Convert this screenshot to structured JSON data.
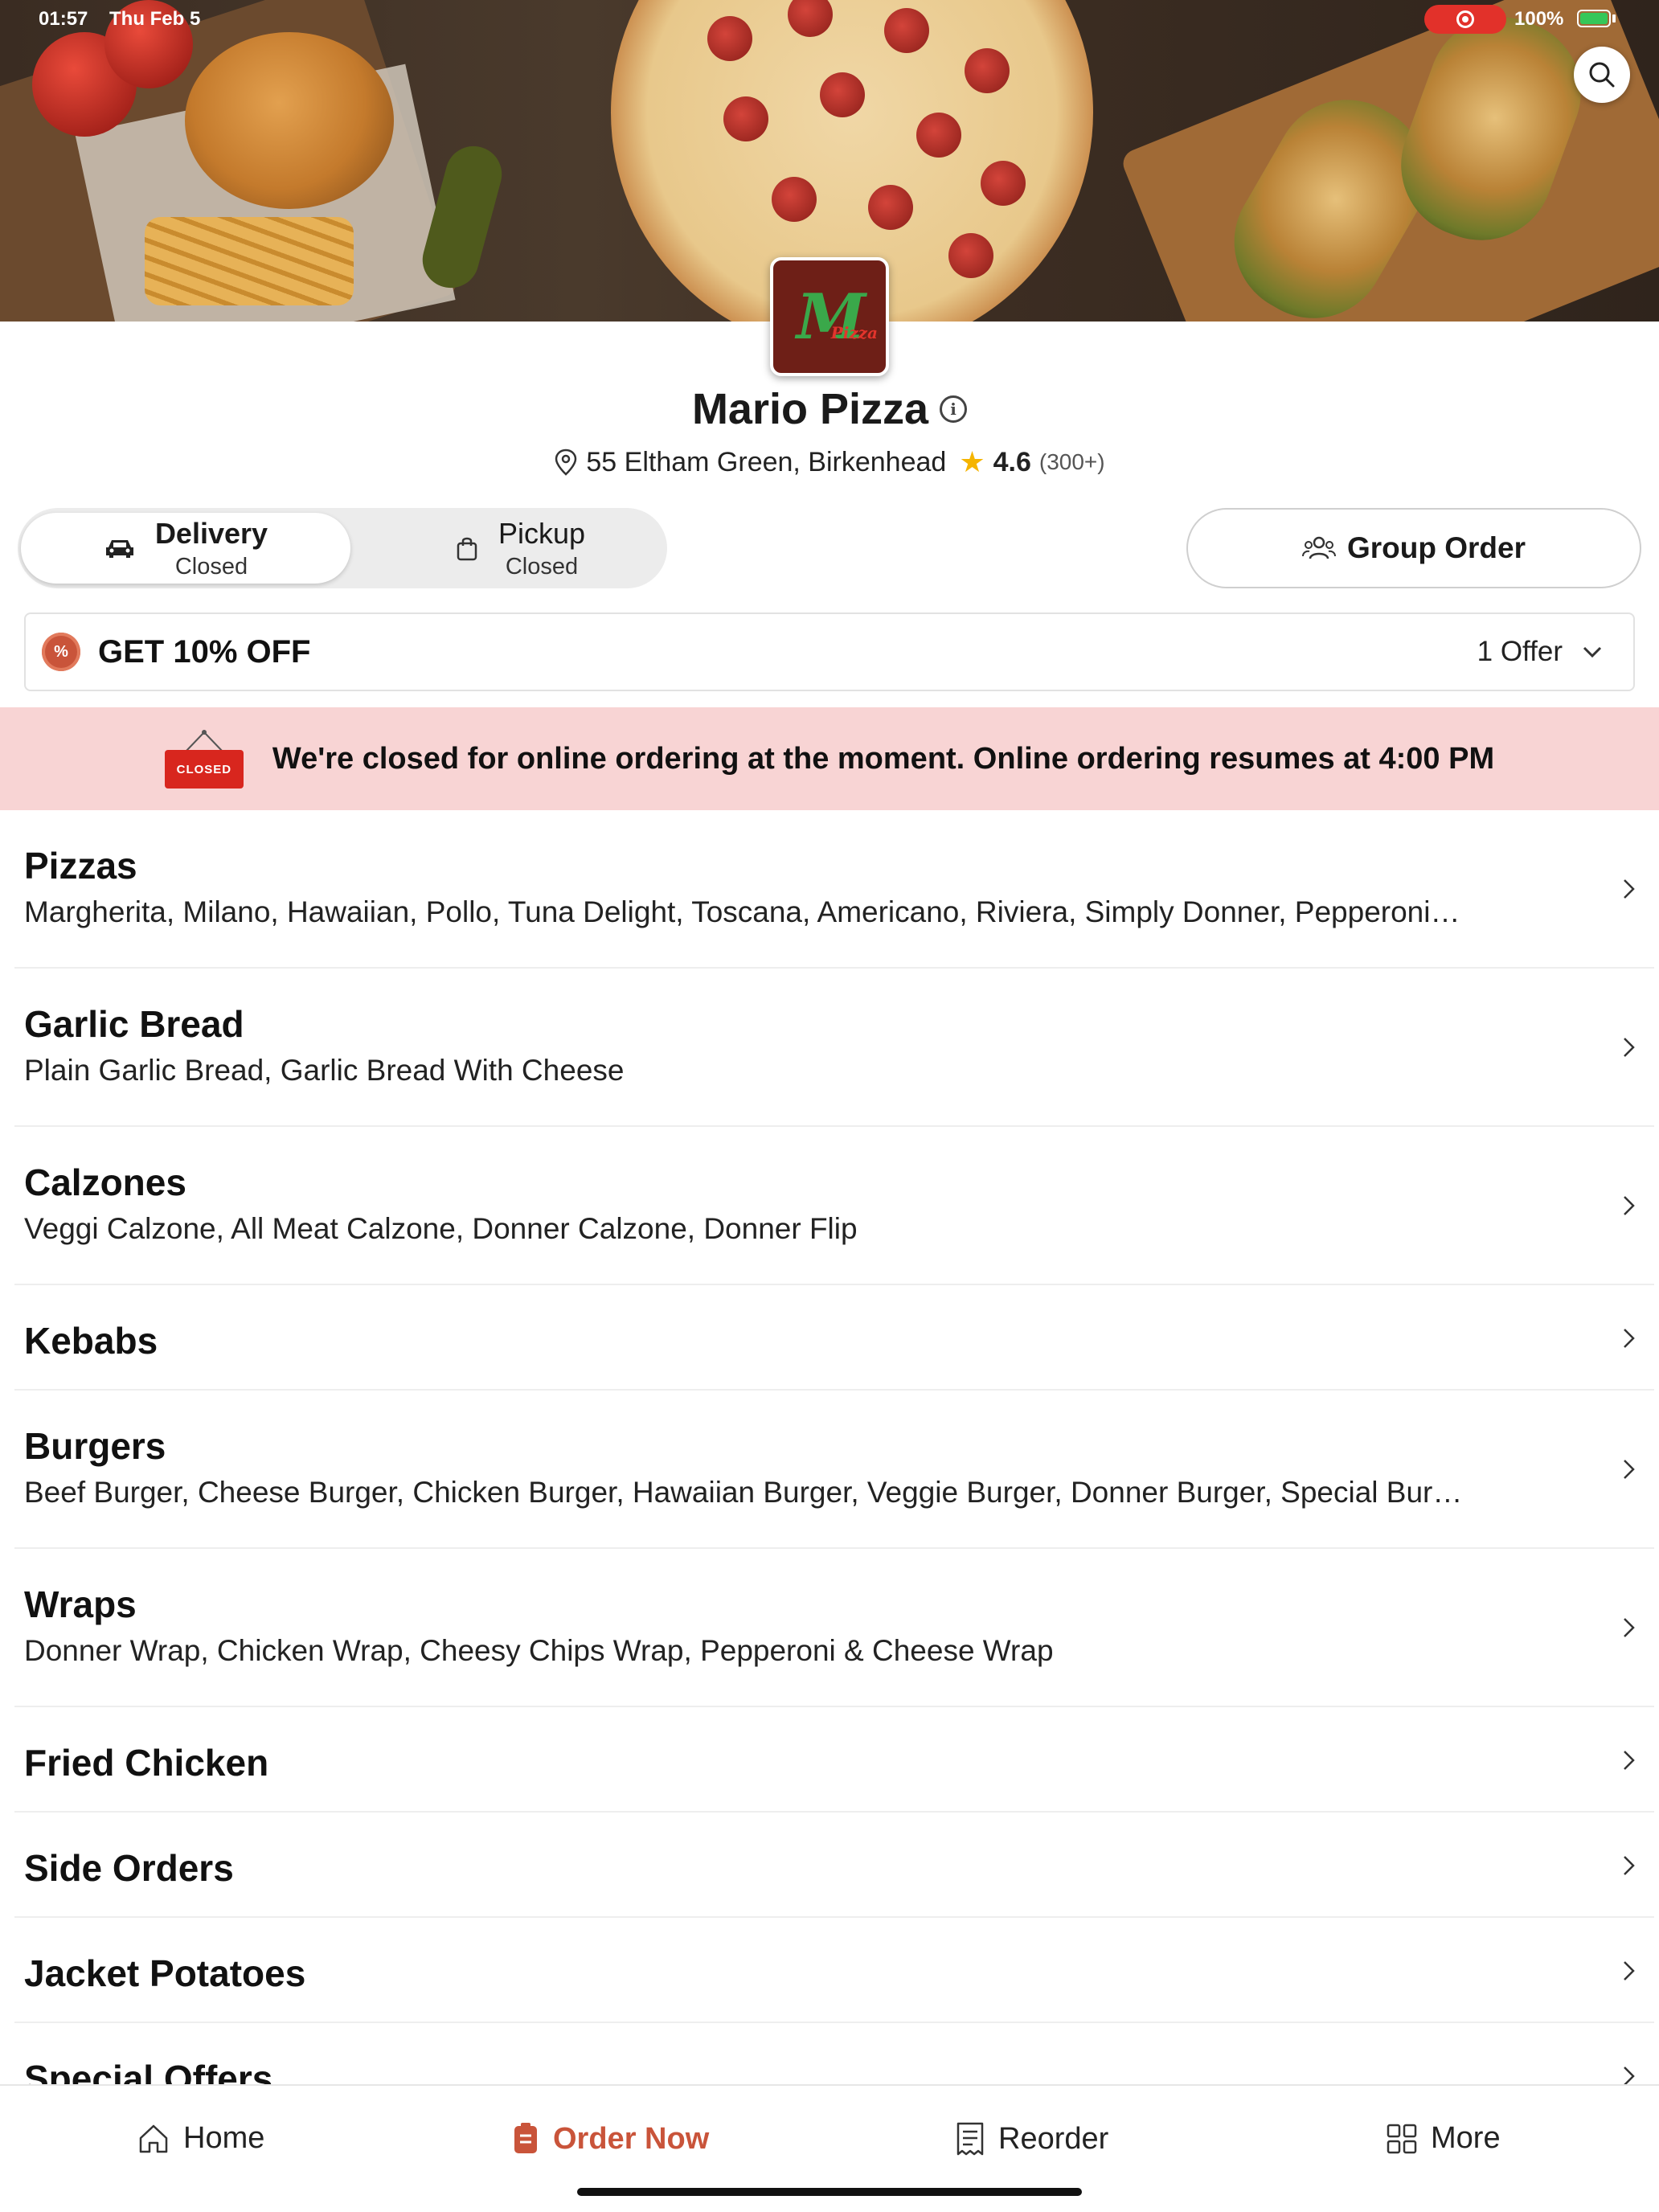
{
  "status_bar": {
    "time": "01:57",
    "date": "Thu Feb 5",
    "battery": "100%"
  },
  "restaurant": {
    "name": "Mario Pizza",
    "address": "55 Eltham Green, Birkenhead",
    "rating": "4.6",
    "rating_count": "(300+)",
    "logo_text": "M",
    "logo_subtext": "Pizza"
  },
  "modes": {
    "delivery": {
      "label": "Delivery",
      "status": "Closed"
    },
    "pickup": {
      "label": "Pickup",
      "status": "Closed"
    }
  },
  "group_order_label": "Group Order",
  "offer": {
    "badge": "%",
    "title": "GET 10% OFF",
    "count": "1 Offer"
  },
  "closed_banner": {
    "sign": "CLOSED",
    "message": "We're closed for online ordering at the moment. Online ordering resumes at 4:00 PM"
  },
  "menu": [
    {
      "title": "Pizzas",
      "desc": "Margherita, Milano, Hawaiian, Pollo, Tuna Delight, Toscana, Americano, Riviera, Simply Donner, Pepperoni…"
    },
    {
      "title": "Garlic Bread",
      "desc": "Plain Garlic Bread, Garlic Bread With Cheese"
    },
    {
      "title": "Calzones",
      "desc": "Veggi Calzone, All Meat Calzone, Donner Calzone, Donner Flip"
    },
    {
      "title": "Kebabs",
      "desc": ""
    },
    {
      "title": "Burgers",
      "desc": "Beef Burger, Cheese Burger, Chicken Burger, Hawaiian Burger, Veggie Burger, Donner Burger, Special Bur…"
    },
    {
      "title": "Wraps",
      "desc": "Donner Wrap, Chicken Wrap, Cheesy Chips Wrap, Pepperoni & Cheese Wrap"
    },
    {
      "title": "Fried Chicken",
      "desc": ""
    },
    {
      "title": "Side Orders",
      "desc": ""
    },
    {
      "title": "Jacket Potatoes",
      "desc": ""
    },
    {
      "title": "Special Offers",
      "desc": ""
    }
  ],
  "bottom_nav": {
    "home": "Home",
    "order_now": "Order Now",
    "reorder": "Reorder",
    "more": "More"
  },
  "colors": {
    "accent": "#c9543a",
    "closed_banner_bg": "#f8d4d4",
    "closed_sign": "#d8261e",
    "star": "#f5b400",
    "recording": "#e2312a"
  }
}
